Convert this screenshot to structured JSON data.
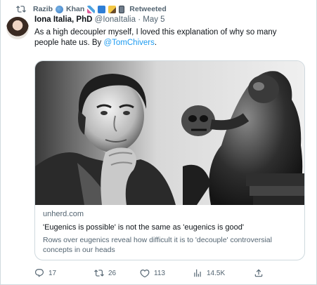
{
  "retweet": {
    "user_name": "Razib",
    "user_name_tail": "Khan",
    "label": "Retweeted",
    "emoji_icons": [
      "globe-icon",
      "dna-icon",
      "book-icon",
      "pen-icon",
      "phone-icon"
    ]
  },
  "tweet": {
    "author_name": "Iona Italia, PhD",
    "author_handle": "@IonaItalia",
    "separator": "·",
    "date": "May 5",
    "text_before": "As a high decoupler myself, I loved this explanation of why so many people hate us. By ",
    "mention": "@TomChivers",
    "text_after": "."
  },
  "card": {
    "domain": "unherd.com",
    "title": "'Eugenics is possible' is not the same as 'eugenics is good'",
    "description": "Rows over eugenics reveal how difficult it is to 'decouple' controversial concepts in our heads"
  },
  "actions": {
    "replies": "17",
    "retweets": "26",
    "likes": "113",
    "views": "14.5K"
  },
  "colors": {
    "accent": "#1d9bf0",
    "secondary_text": "#536471",
    "primary_text": "#0f1419",
    "border": "#cfd9de"
  }
}
